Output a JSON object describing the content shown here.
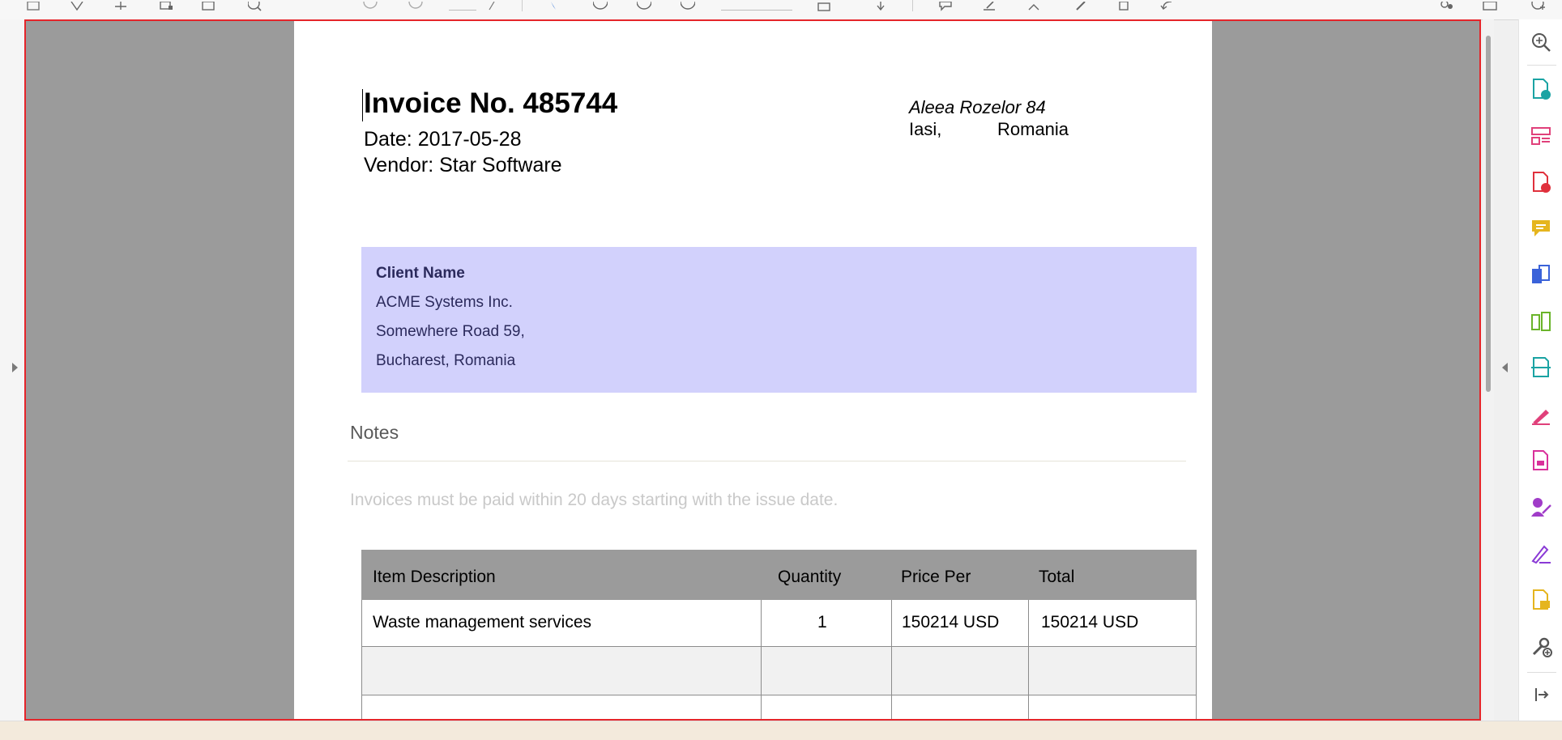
{
  "toolbar": {
    "icons": [
      "save-icon",
      "bookmark-icon",
      "compare-icon",
      "print-icon",
      "share-icon",
      "search-icon",
      "page-up-icon",
      "page-down-icon",
      "cursor-icon",
      "zoom-out-icon",
      "zoom-in-icon",
      "hand-icon",
      "fit-page-icon",
      "scroll-icon",
      "comment-icon",
      "highlight-icon",
      "sign-icon",
      "edit-icon",
      "delete-icon",
      "undo-icon",
      "account-icon",
      "mail-icon",
      "add-icon"
    ]
  },
  "invoice": {
    "title": "Invoice No. 485744",
    "date_line": "Date: 2017-05-28",
    "vendor_line": "Vendor: Star Software",
    "address_line1": "Aleea Rozelor 84",
    "address_city": "Iasi,",
    "address_country": "Romania"
  },
  "client": {
    "heading": "Client Name",
    "name": "ACME Systems Inc.",
    "street": "Somewhere Road 59,",
    "city": "Bucharest, Romania"
  },
  "notes": {
    "heading": "Notes",
    "text": "Invoices must be paid within 20 days starting with the issue date."
  },
  "table": {
    "headers": [
      "Item Description",
      "Quantity",
      "Price Per",
      "Total"
    ],
    "rows": [
      [
        "Waste management services",
        "1",
        "150214 USD",
        "150214 USD"
      ],
      [
        "",
        "",
        "",
        ""
      ],
      [
        "",
        "",
        "",
        ""
      ]
    ]
  },
  "right_panel": {
    "tools": [
      {
        "icon": "zoom-icon",
        "color": "#555555"
      },
      {
        "icon": "create-pdf-icon",
        "color": "#1aa3a3"
      },
      {
        "icon": "organize-pages-icon",
        "color": "#e0407a"
      },
      {
        "icon": "export-pdf-icon",
        "color": "#e0303c"
      },
      {
        "icon": "comment-icon",
        "color": "#e5b51e"
      },
      {
        "icon": "combine-files-icon",
        "color": "#3a62d9"
      },
      {
        "icon": "compare-icon",
        "color": "#6ab42a"
      },
      {
        "icon": "scan-icon",
        "color": "#1aa3a3"
      },
      {
        "icon": "fill-sign-icon",
        "color": "#e0407a"
      },
      {
        "icon": "protect-icon",
        "color": "#d9309a"
      },
      {
        "icon": "send-for-signature-icon",
        "color": "#a03cc8"
      },
      {
        "icon": "certificates-icon",
        "color": "#8a3ad6"
      },
      {
        "icon": "send-for-comments-icon",
        "color": "#e5b51e"
      },
      {
        "icon": "more-tools-icon",
        "color": "#555555"
      },
      {
        "icon": "collapse-panel-icon",
        "color": "#555555"
      }
    ]
  }
}
